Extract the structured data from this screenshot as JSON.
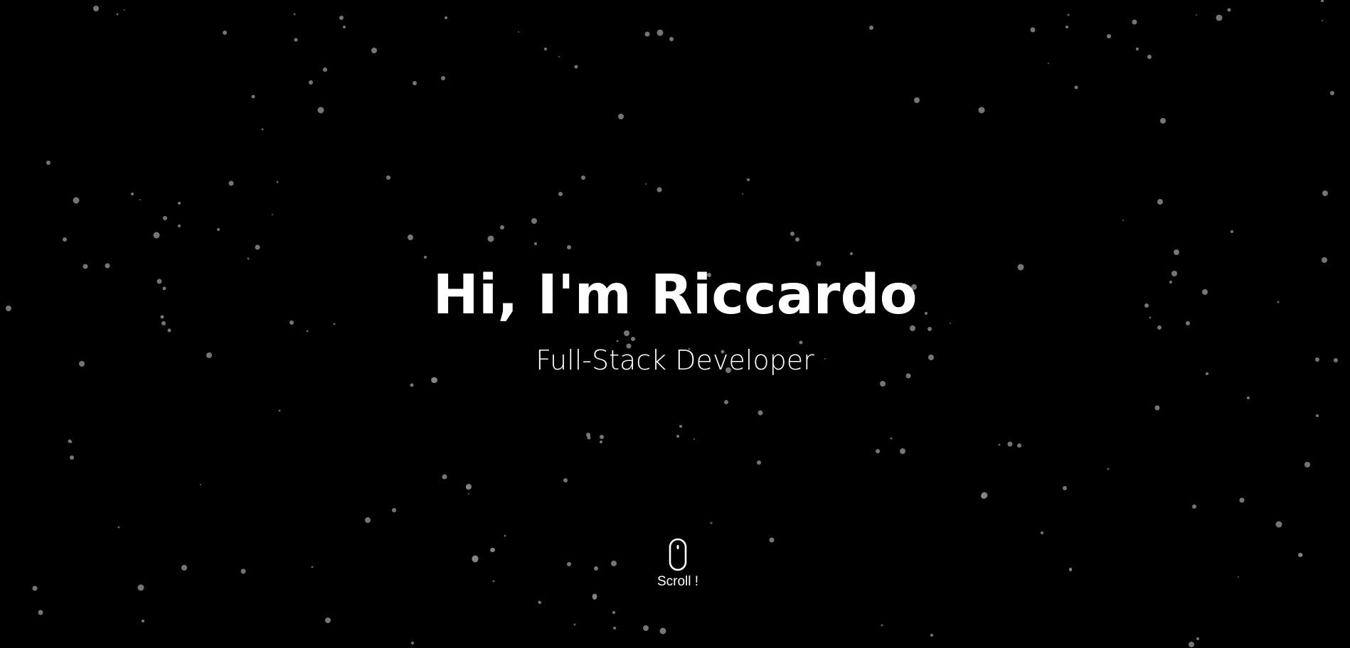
{
  "hero": {
    "headline": "Hi, I'm Riccardo",
    "subtitle": "Full-Stack Developer",
    "scroll_label": "Scroll !",
    "scroll_icon": "mouse-icon"
  },
  "colors": {
    "background": "#000000",
    "text": "#ffffff",
    "star": "#8a8a8a"
  }
}
